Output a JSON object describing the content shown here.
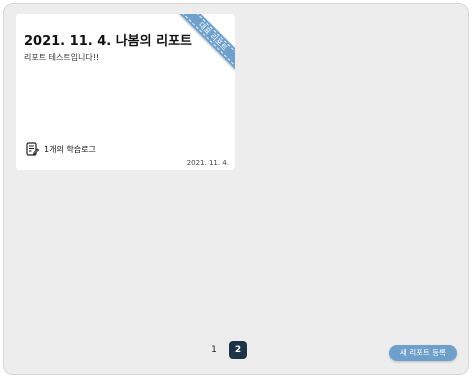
{
  "report_card": {
    "title": "2021. 11. 4. 나봄의 리포트",
    "description": "리포트 테스트입니다!!",
    "ribbon_label": "대표 리포트",
    "log_count_label": "1개의 학습로그",
    "date": "2021. 11. 4.",
    "log_icon": "document-edit-icon"
  },
  "pagination": {
    "pages": [
      "1",
      "2"
    ],
    "current": "2"
  },
  "actions": {
    "new_report_label": "새 리포트 등록"
  },
  "colors": {
    "accent": "#6fa0cc",
    "active_page": "#1f3347",
    "panel_bg": "#ededed"
  }
}
